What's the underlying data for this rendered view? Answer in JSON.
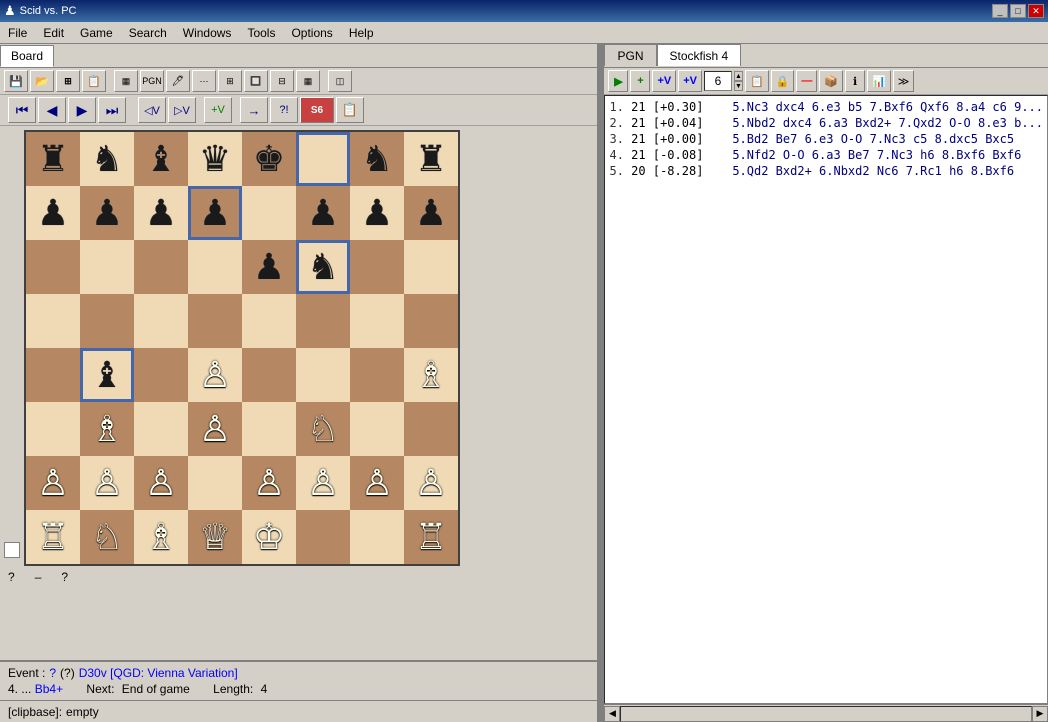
{
  "app": {
    "title": "Scid vs. PC",
    "icon": "♟"
  },
  "titlebar": {
    "controls": [
      "_",
      "□",
      "✕"
    ]
  },
  "menubar": {
    "items": [
      "File",
      "Edit",
      "Game",
      "Search",
      "Windows",
      "Tools",
      "Options",
      "Help"
    ]
  },
  "board_tab": {
    "label": "Board"
  },
  "toolbar1": {
    "buttons": [
      "💾",
      "📂",
      "📋",
      "📌",
      "📊",
      "📈"
    ]
  },
  "nav_toolbar": {
    "buttons": [
      "⏮",
      "◀",
      "▶",
      "⏭"
    ]
  },
  "right_tabs": {
    "pgn_label": "PGN",
    "engine_label": "Stockfish 4"
  },
  "engine_toolbar": {
    "play_label": "▶",
    "plus_label": "+",
    "plus_v_label": "+V",
    "plus_v2_label": "+V",
    "num_value": "6",
    "spin_up": "▲",
    "spin_down": "▼",
    "icons": [
      "📋",
      "🔒",
      "—",
      "📦",
      "ℹ",
      "📊",
      "≫"
    ]
  },
  "analysis_lines": [
    {
      "num": "1.",
      "depth": "21",
      "score": "[+0.30]",
      "moves": "5.Nc3 dxc4 6.e3 b5 7.Bxf6 Qxf6 8.a4 c6 9..."
    },
    {
      "num": "2.",
      "depth": "21",
      "score": "[+0.04]",
      "moves": "5.Nbd2 dxc4 6.a3 Bxd2+ 7.Qxd2 O-O 8.e3 b..."
    },
    {
      "num": "3.",
      "depth": "21",
      "score": "[+0.00]",
      "moves": "5.Bd2 Be7 6.e3 O-O 7.Nc3 c5 8.dxc5 Bxc5"
    },
    {
      "num": "4.",
      "depth": "21",
      "score": "[-0.08]",
      "moves": "5.Nfd2 O-O 6.a3 Be7 7.Nc3 h6 8.Bxf6 Bxf6"
    },
    {
      "num": "5.",
      "depth": "20",
      "score": "[-8.28]",
      "moves": "5.Qd2 Bxd2+ 6.Nbxd2 Nc6 7.Rc1 h6 8.Bxf6"
    }
  ],
  "board": {
    "position": [
      [
        "r",
        "n",
        "b",
        "q",
        "k",
        "",
        "n",
        "r"
      ],
      [
        "p",
        "p",
        "p",
        "p",
        "",
        "p",
        "p",
        "p"
      ],
      [
        "",
        "",
        "",
        "",
        "p",
        "n",
        "",
        ""
      ],
      [
        "",
        "",
        "",
        "",
        "",
        "",
        "",
        ""
      ],
      [
        "",
        "b",
        "",
        "P",
        "",
        "",
        "",
        ""
      ],
      [
        "",
        "B",
        "",
        "",
        "",
        "N",
        "",
        ""
      ],
      [
        "P",
        "P",
        "P",
        "",
        "P",
        "P",
        "P",
        "P"
      ],
      [
        "R",
        "N",
        "B",
        "Q",
        "K",
        "",
        "",
        "R"
      ]
    ],
    "highlights": [
      [
        0,
        5
      ],
      [
        1,
        3
      ],
      [
        3,
        1
      ],
      [
        2,
        5
      ]
    ]
  },
  "scores": {
    "q1": "?",
    "q2": "–",
    "q3": "?"
  },
  "info": {
    "event_label": "Event :",
    "event_value": "?",
    "event_parens": "(?)",
    "opening": "D30v [QGD: Vienna Variation]",
    "move_num": "4.",
    "move_dots": "...",
    "move": "Bb4+",
    "next_label": "Next:",
    "next_value": "End of game",
    "length_label": "Length:",
    "length_value": "4"
  },
  "clipbase": {
    "label": "[clipbase]:",
    "status": "empty"
  }
}
